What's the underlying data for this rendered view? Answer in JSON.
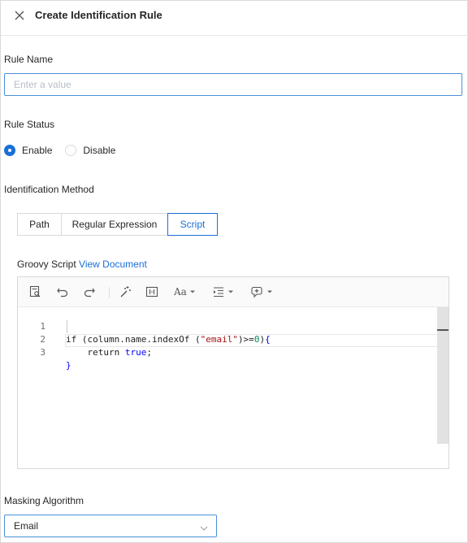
{
  "header": {
    "title": "Create Identification Rule",
    "close_icon": "close-icon"
  },
  "rule_name": {
    "label": "Rule Name",
    "placeholder": "Enter a value",
    "value": ""
  },
  "rule_status": {
    "label": "Rule Status",
    "options": [
      {
        "label": "Enable",
        "checked": true
      },
      {
        "label": "Disable",
        "checked": false
      }
    ]
  },
  "identification_method": {
    "label": "Identification Method",
    "tabs": [
      {
        "label": "Path",
        "active": false
      },
      {
        "label": "Regular Expression",
        "active": false
      },
      {
        "label": "Script",
        "active": true
      }
    ]
  },
  "groovy": {
    "label": "Groovy Script",
    "link": "View Document"
  },
  "editor": {
    "toolbar_icons": [
      "search-doc-icon",
      "undo-icon",
      "redo-icon",
      "magic-wand-icon",
      "format-icon",
      "font-size-icon",
      "indent-icon",
      "insert-icon"
    ],
    "toolbar_font_label": "Aa",
    "lines": [
      {
        "num": "1",
        "text": "if (column.name.indexOf (\"email\")>=0){"
      },
      {
        "num": "2",
        "text": "    return true;"
      },
      {
        "num": "3",
        "text": "}"
      }
    ]
  },
  "masking": {
    "label": "Masking Algorithm",
    "selected": "Email"
  },
  "colors": {
    "accent": "#1a6fd6",
    "border": "#d9d9d9",
    "string": "#a31515",
    "keyword_true": "#0000ff"
  }
}
